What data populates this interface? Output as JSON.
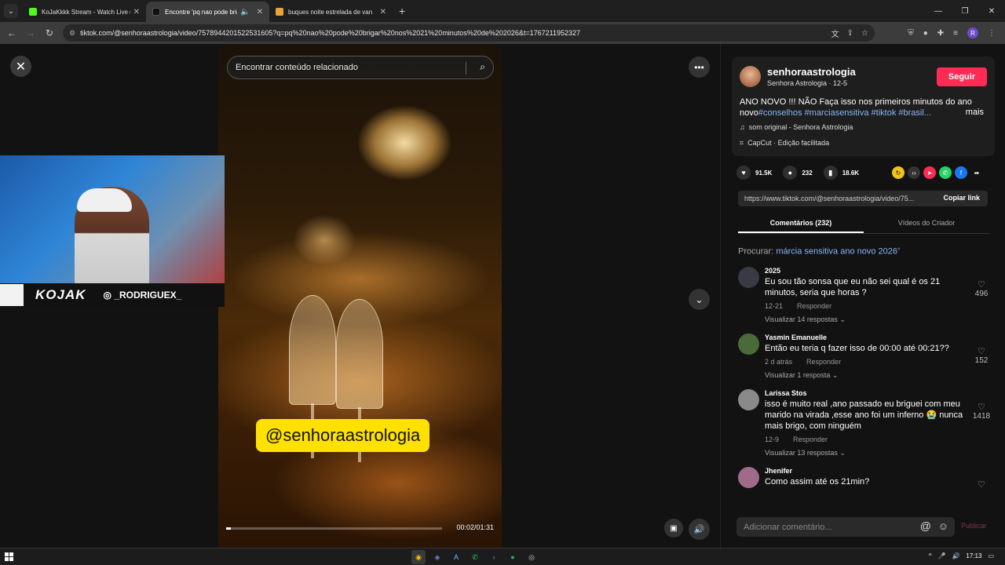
{
  "browser": {
    "tabs": [
      {
        "title": "KoJaKkkk Stream - Watch Live o",
        "icon_color": "#53fc18",
        "active": false
      },
      {
        "title": "Encontre 'pq nao pode brig",
        "icon_color": "#000000",
        "active": true
      },
      {
        "title": "buques noite estrelada de van",
        "icon_color": "#e8a33a",
        "active": false
      }
    ],
    "url": "tiktok.com/@senhoraastrologia/video/7578944201522531605?q=pq%20nao%20pode%20brigar%20nos%2021%20minutos%20de%202026&t=1767211952327",
    "profile_initial": "R"
  },
  "video": {
    "search_placeholder": "Encontrar conteúdo relacionado",
    "caption": "@senhoraastrologia",
    "time": "00:02/01:31",
    "progress_fraction": 0.022
  },
  "stream_overlay": {
    "logo": "KOJAK",
    "instagram": "_RODRIGUEX_"
  },
  "post": {
    "author": "senhoraastrologia",
    "author_sub": "Senhora Astrologia · 12-5",
    "follow_label": "Seguir",
    "description": "ANO NOVO !!! NÃO Faça isso nos primeiros minutos do ano novo",
    "tags": "#conselhos #marciasensitiva #tiktok #brasil...",
    "more_label": "mais",
    "music": "som original - Senhora Astrologia",
    "capcut": "CapCut · Edição facilitada",
    "likes": "91.5K",
    "comments": "232",
    "saves": "18.6K",
    "link": "https://www.tiktok.com/@senhoraastrologia/video/75...",
    "copy_link": "Copiar link"
  },
  "tabs": {
    "comments_label": "Comentários (232)",
    "creator_label": "Vídeos do Criador"
  },
  "search_suggestion": {
    "prefix": "Procurar:",
    "query": "márcia sensitiva ano novo 2026"
  },
  "comments": [
    {
      "name": "2025",
      "text": "Eu sou tão sonsa que eu não sei qual é os 21 minutos, seria que horas ?",
      "date": "12-21",
      "reply": "Responder",
      "replies": "Visualizar 14 respostas",
      "likes": "496",
      "avatar_color": "#3a3a44"
    },
    {
      "name": "Yasmin Emanuelle",
      "text": "Então eu teria q fazer isso de 00:00 até 00:21??",
      "date": "2 d atrás",
      "reply": "Responder",
      "replies": "Visualizar 1 resposta",
      "likes": "152",
      "avatar_color": "#4a6a3a"
    },
    {
      "name": "Larissa Stos",
      "text": "isso é muito real ,ano passado eu briguei com meu marido na virada ,esse ano foi um inferno 😭 nunca mais brigo, com ninguém",
      "date": "12-9",
      "reply": "Responder",
      "replies": "Visualizar 13 respostas",
      "likes": "1418",
      "avatar_color": "#8a8a8a"
    },
    {
      "name": "Jhenifer",
      "text": "Como assim até os 21min?",
      "date": "",
      "reply": "",
      "replies": "",
      "likes": "",
      "avatar_color": "#a06a8a"
    }
  ],
  "add_comment": {
    "placeholder": "Adicionar comentário...",
    "publish": "Publicar"
  },
  "taskbar": {
    "time": "17:13"
  }
}
